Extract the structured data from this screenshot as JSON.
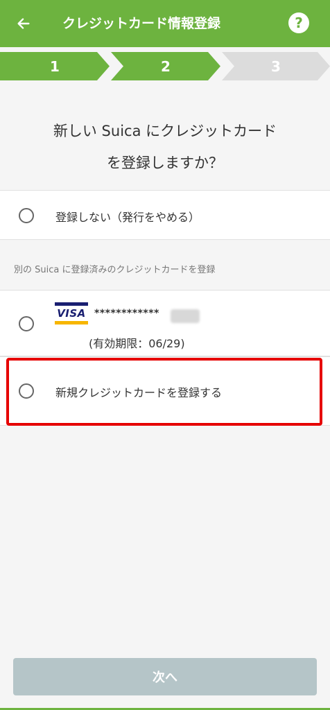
{
  "header": {
    "title": "クレジットカード情報登録",
    "help_label": "?"
  },
  "steps": [
    {
      "label": "1",
      "state": "done"
    },
    {
      "label": "2",
      "state": "current"
    },
    {
      "label": "3",
      "state": "upcoming"
    }
  ],
  "question": {
    "line1": "新しい Suica にクレジットカード",
    "line2": "を登録しますか？"
  },
  "options": {
    "no_register": "登録しない（発行をやめる）",
    "section_label": "別の Suica に登録済みのクレジットカードを登録",
    "existing_card": {
      "brand": "VISA",
      "number_masked": "************",
      "expiry": "(有効期限：06/29)"
    },
    "new_card": "新規クレジットカードを登録する"
  },
  "footer": {
    "next_label": "次へ"
  },
  "colors": {
    "brand_green": "#6db33f",
    "highlight_red": "#e60000",
    "disabled_button": "#b5c5c8"
  },
  "icons": {
    "back": "arrow-left-icon",
    "help": "help-icon",
    "visa": "visa-logo"
  }
}
